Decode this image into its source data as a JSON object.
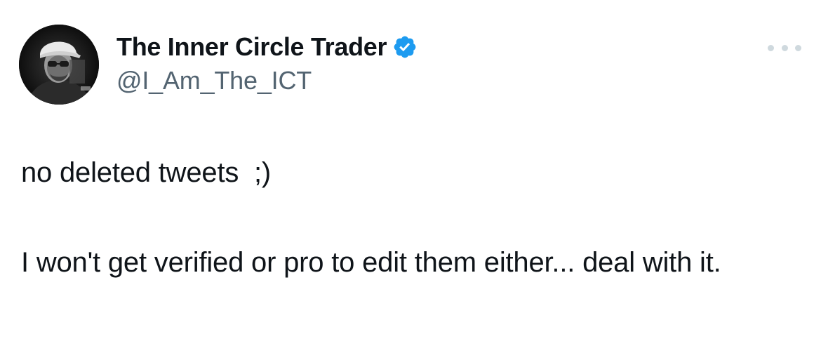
{
  "author": {
    "display_name": "The Inner Circle Trader",
    "handle": "@I_Am_The_ICT",
    "verified": true,
    "verified_color": "#1d9bf0"
  },
  "menu": {
    "icon": "more-horizontal-icon"
  },
  "tweet": {
    "paragraphs": [
      "no deleted tweets  ;)",
      "I won't get verified or pro to edit them either... deal with it."
    ]
  },
  "colors": {
    "text_primary": "#0f1419",
    "text_secondary": "#536471",
    "dots": "#cfd9de"
  }
}
